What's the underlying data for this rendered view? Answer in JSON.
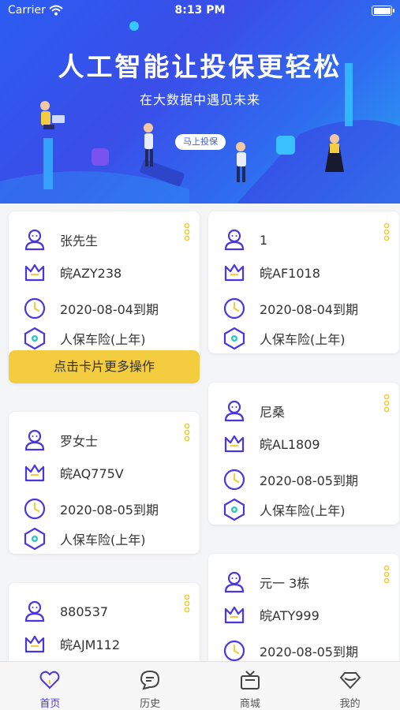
{
  "status_bar": {
    "carrier": "Carrier",
    "time": "8:13 PM"
  },
  "banner": {
    "headline": "人工智能让投保更轻松",
    "subline": "在大数据中遇见未来",
    "cta_label": "马上投保"
  },
  "cards": [
    {
      "name": "张先生",
      "plate": "皖AZY238",
      "expiry": "2020-08-04到期",
      "insurance": "人保车险(上年)",
      "action_label": "点击卡片更多操作"
    },
    {
      "name": "1",
      "plate": "皖AF1018",
      "expiry": "2020-08-04到期",
      "insurance": "人保车险(上年)"
    },
    {
      "name": "罗女士",
      "plate": "皖AQ775V",
      "expiry": "2020-08-05到期",
      "insurance": "人保车险(上年)"
    },
    {
      "name": "尼桑",
      "plate": "皖AL1809",
      "expiry": "2020-08-05到期",
      "insurance": "人保车险(上年)"
    },
    {
      "name": "880537",
      "plate": "皖AJM112"
    },
    {
      "name": "元一 3栋",
      "plate": "皖ATY999",
      "expiry": "2020-08-05到期"
    }
  ],
  "tabbar": [
    {
      "label": "首页",
      "icon": "heart-icon",
      "active": true
    },
    {
      "label": "历史",
      "icon": "chat-icon",
      "active": false
    },
    {
      "label": "商城",
      "icon": "tv-icon",
      "active": false
    },
    {
      "label": "我的",
      "icon": "diamond-icon",
      "active": false
    }
  ],
  "colors": {
    "accent": "#4a36e0",
    "highlight": "#f3cc3f",
    "banner": "#2b5cf2"
  }
}
